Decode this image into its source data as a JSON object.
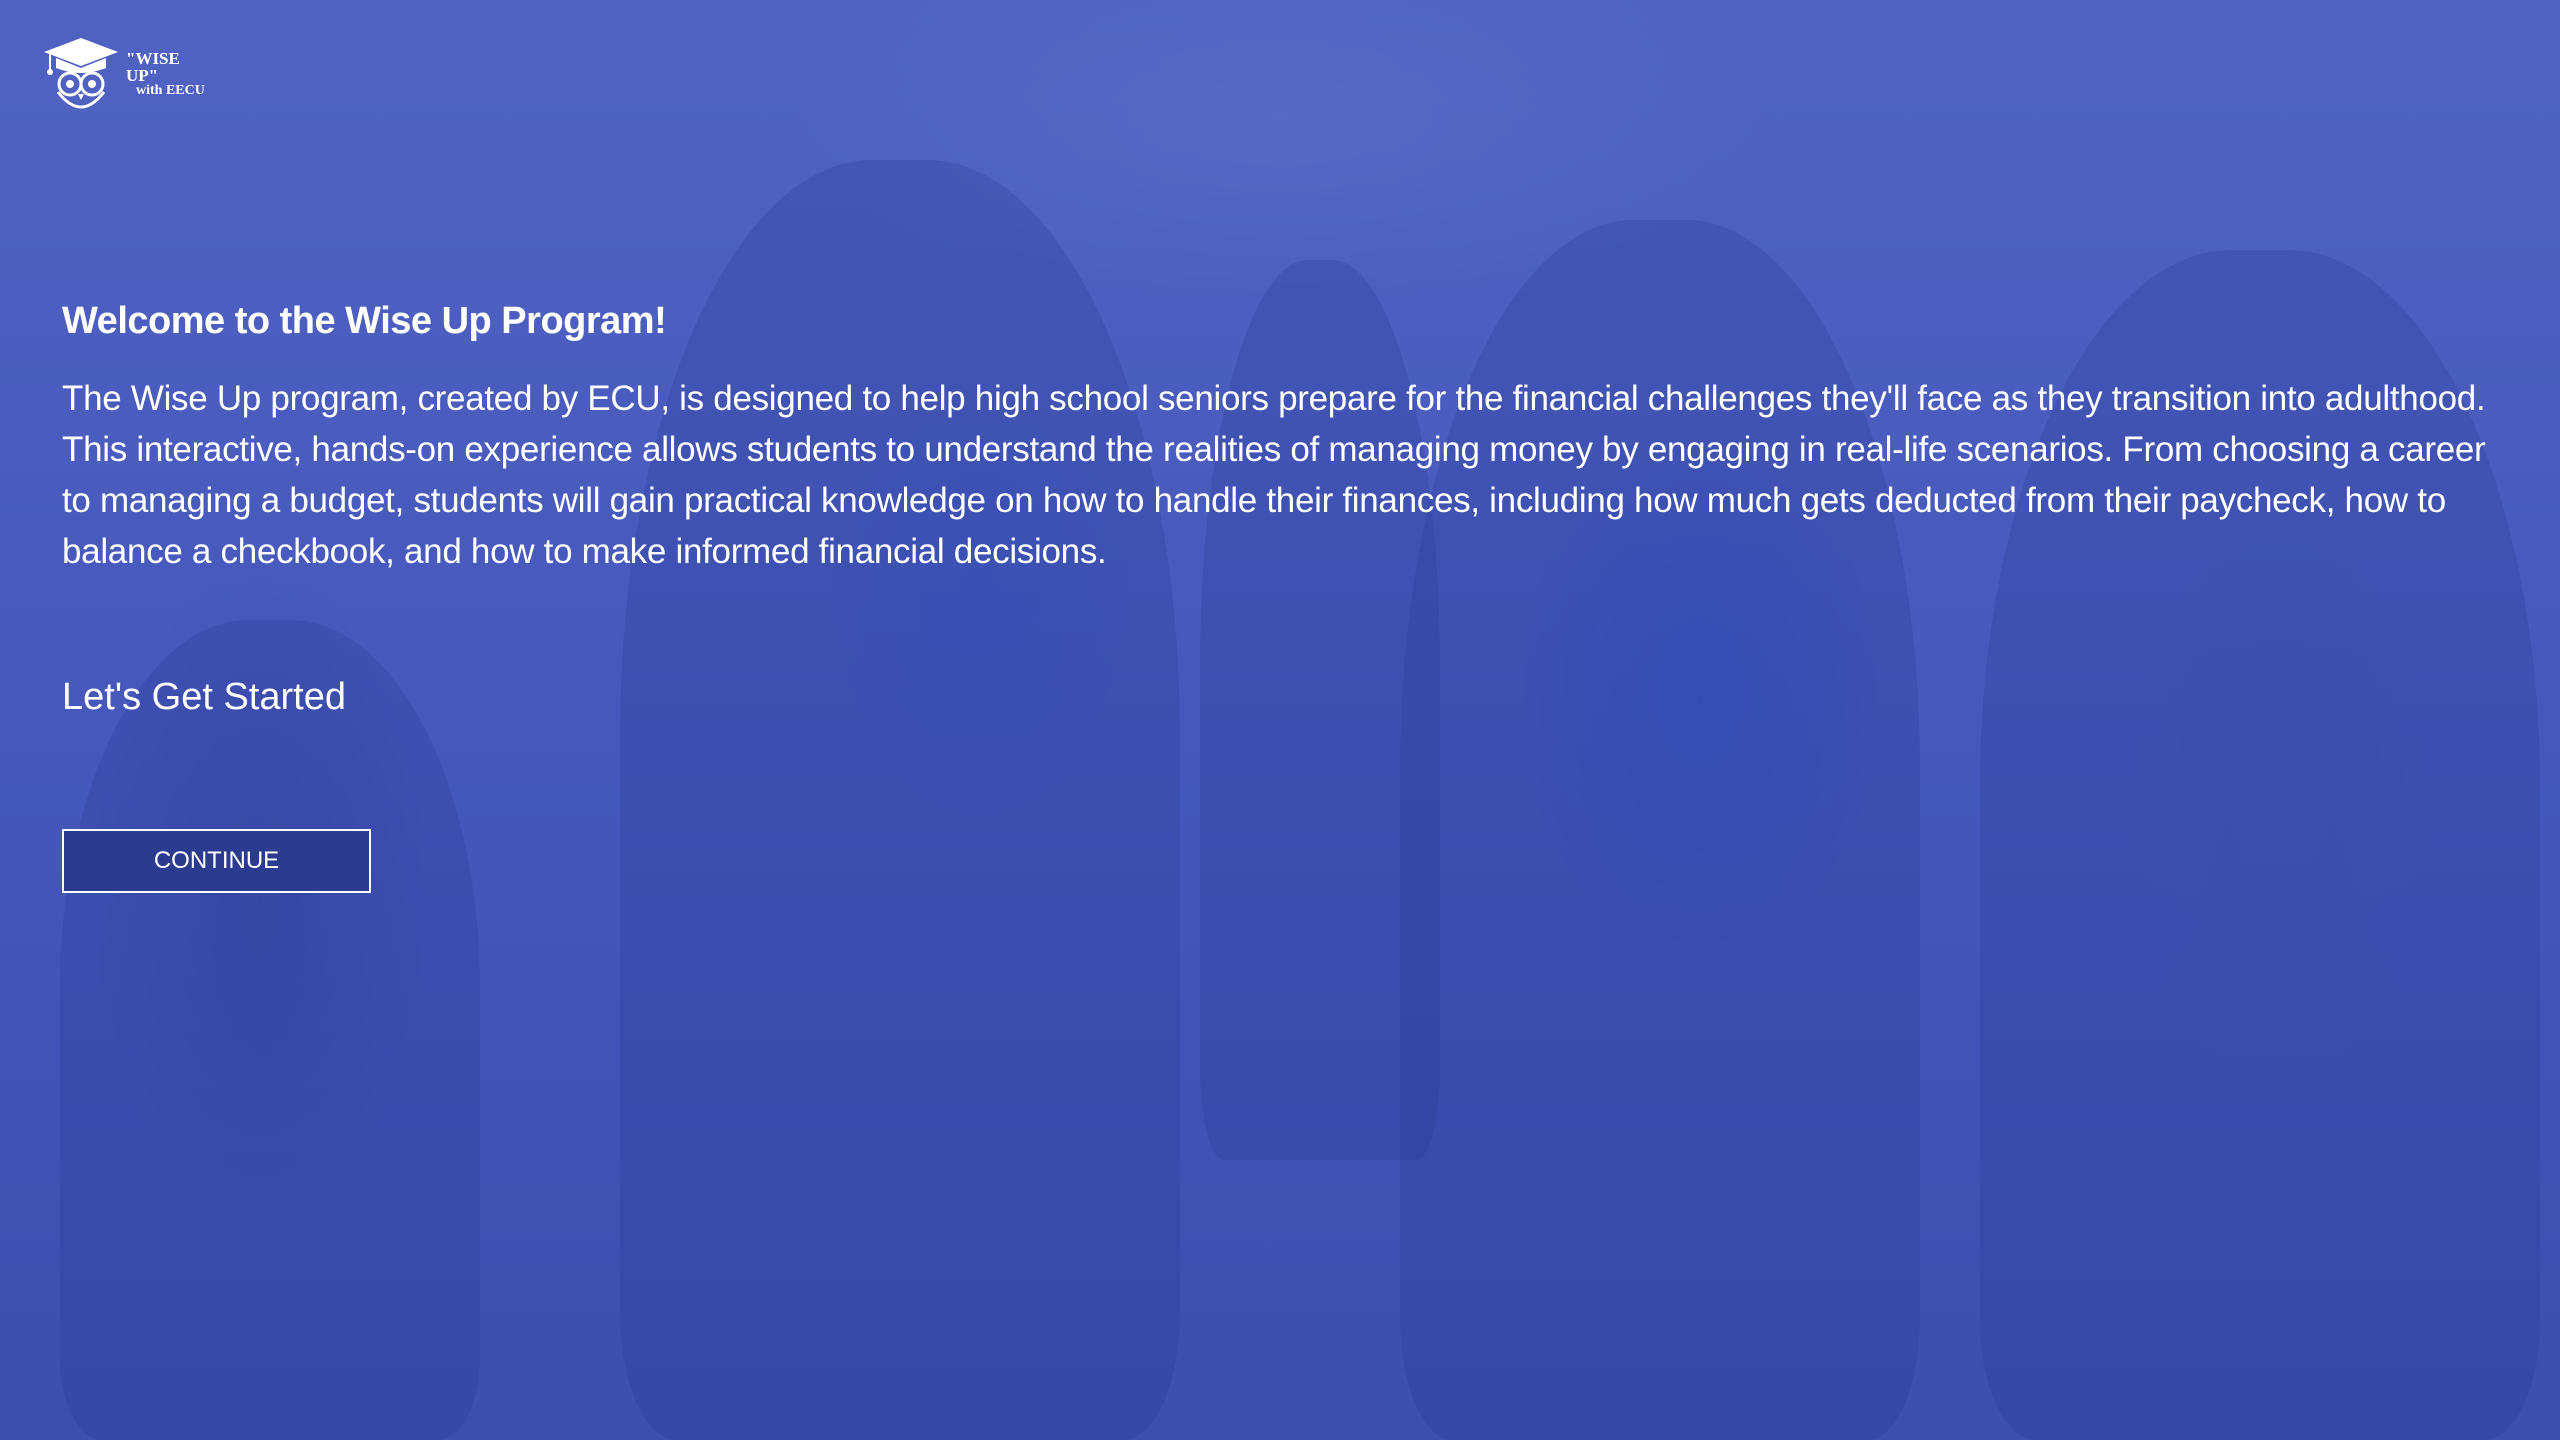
{
  "logo": {
    "line1": "\"WISE UP\"",
    "line2": "with EECU",
    "icon": "owl-graduation-cap-icon"
  },
  "main": {
    "heading": "Welcome to the Wise Up Program!",
    "intro": "The Wise Up program, created by ECU, is designed to help high school seniors prepare for the financial challenges they'll face as they transition into adulthood. This interactive, hands-on experience allows students to understand the realities of managing money by engaging in real-life scenarios. From choosing a career to managing a budget, students will gain practical knowledge on how to handle their finances, including how much gets deducted from their paycheck, how to balance a checkbook, and how to make informed financial decisions.",
    "get_started": "Let's Get Started",
    "continue_label": "CONTINUE"
  },
  "colors": {
    "overlay": "#4054be",
    "button_bg": "#2b3b8f",
    "text": "#ffffff"
  }
}
